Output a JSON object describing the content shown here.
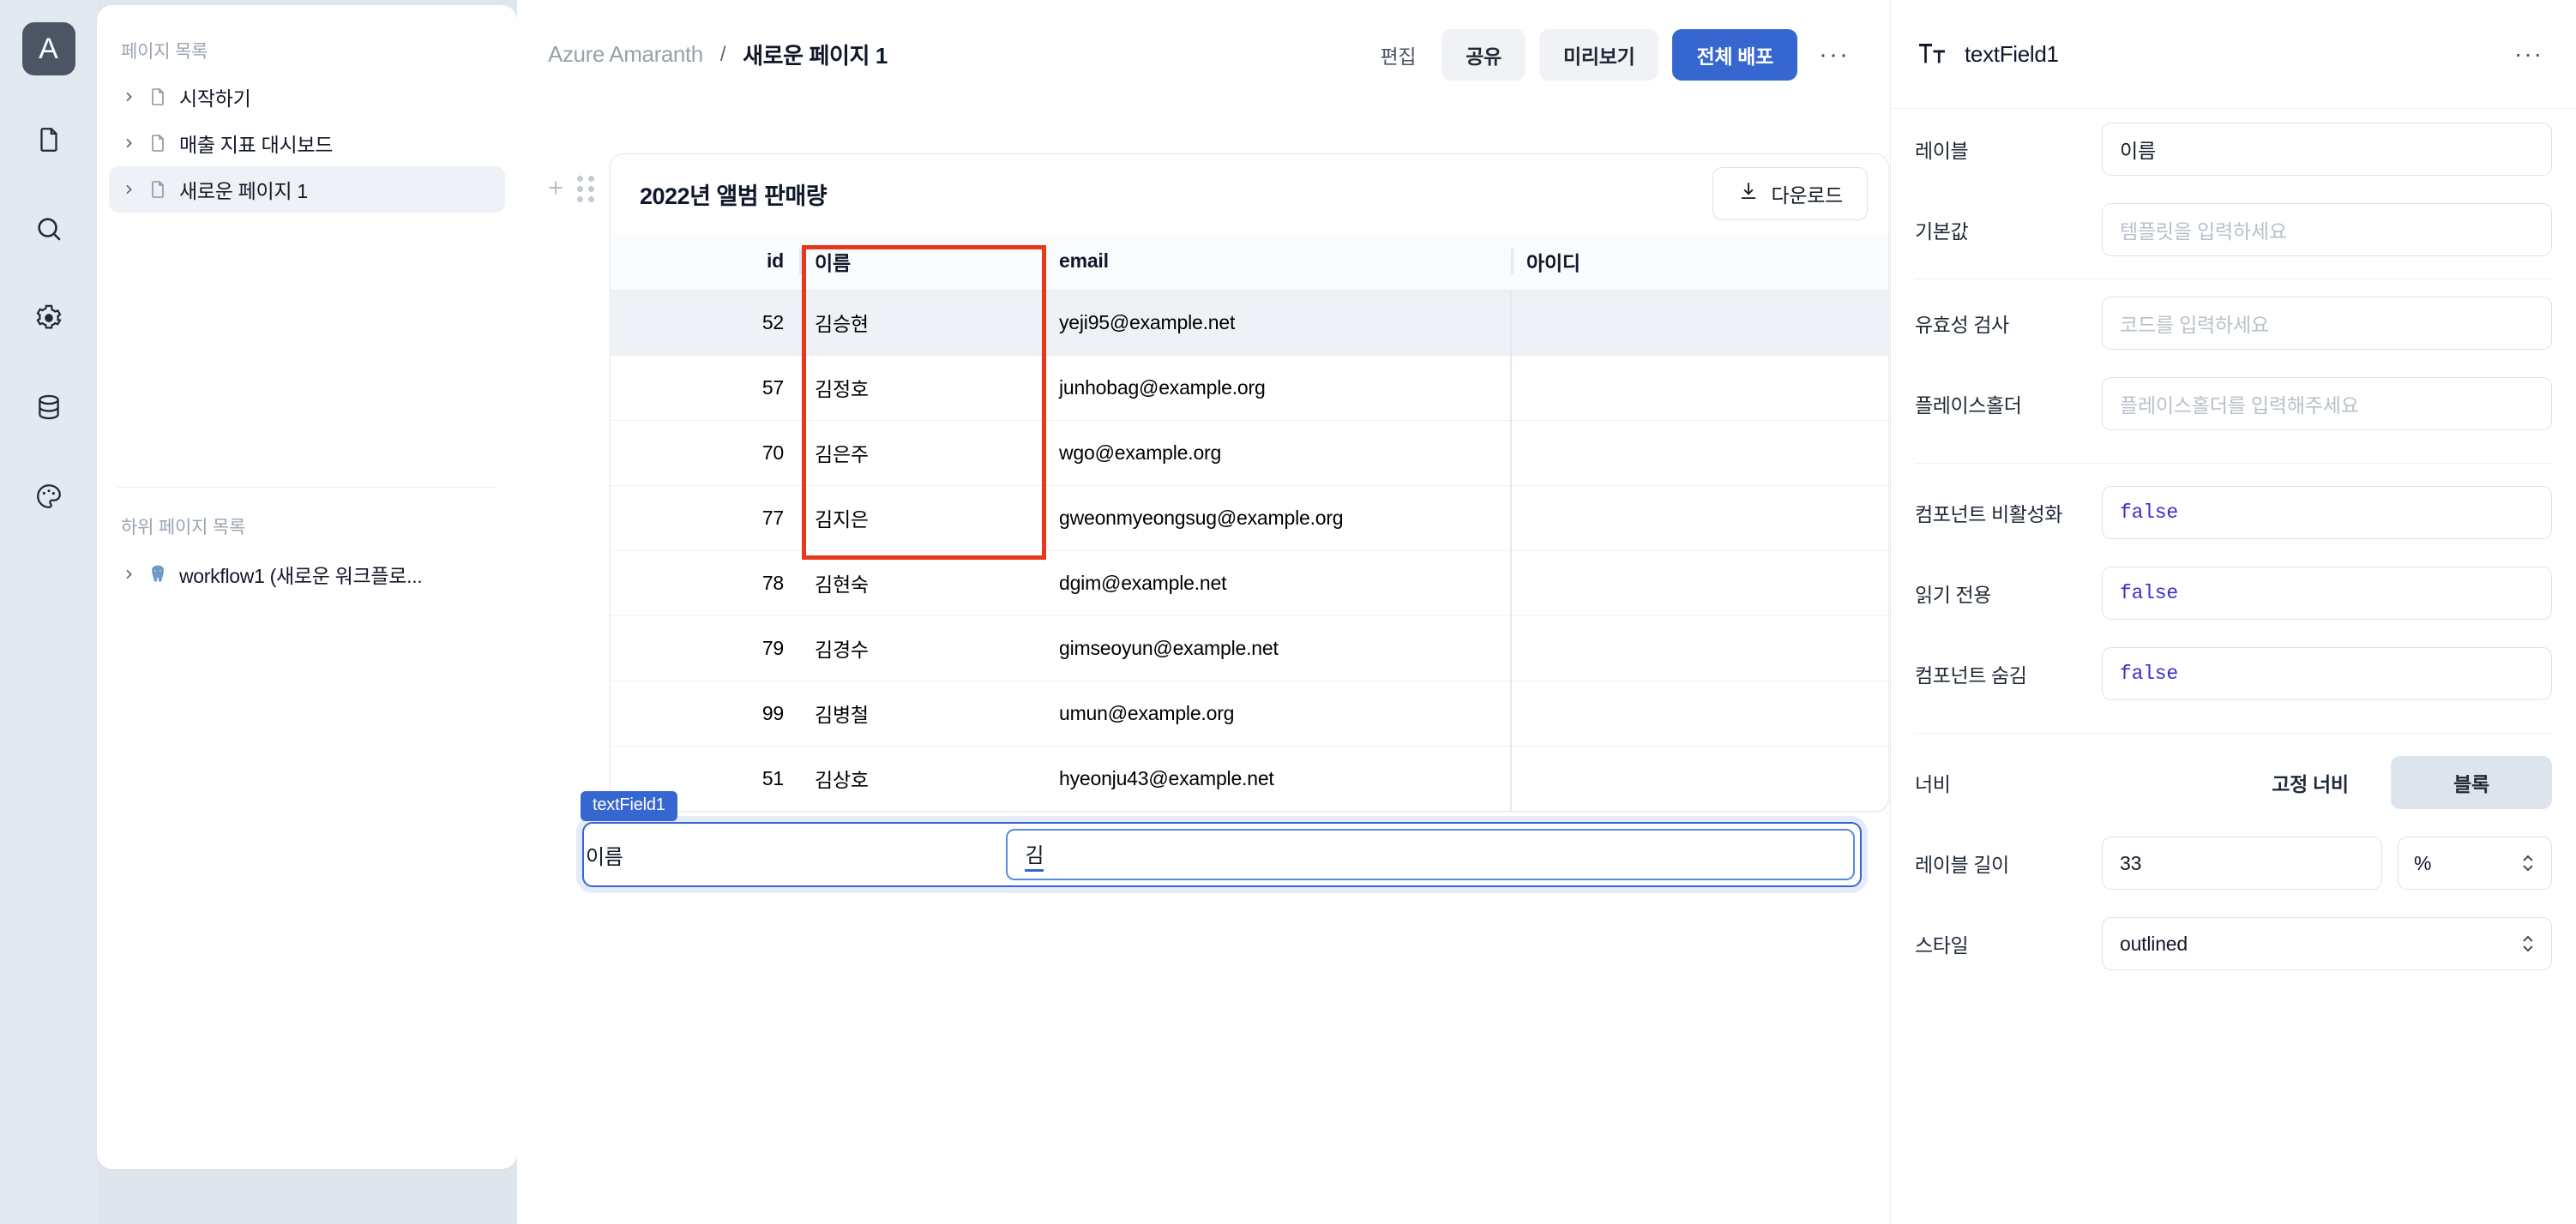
{
  "rail": {
    "logo_label": "A",
    "icons": [
      {
        "name": "page-icon"
      },
      {
        "name": "search-icon"
      },
      {
        "name": "gear-icon"
      },
      {
        "name": "database-icon"
      },
      {
        "name": "palette-icon"
      }
    ]
  },
  "pages_panel": {
    "heading": "페이지 목록",
    "items": [
      {
        "label": "시작하기",
        "icon": "document-icon",
        "active": false
      },
      {
        "label": "매출 지표 대시보드",
        "icon": "document-icon",
        "active": false
      },
      {
        "label": "새로운 페이지 1",
        "icon": "document-icon",
        "active": true
      }
    ],
    "subheading": "하위 페이지 목록",
    "subitems": [
      {
        "label": "workflow1 (새로운 워크플로...",
        "icon": "postgresql-icon"
      }
    ]
  },
  "topbar": {
    "breadcrumb_root": "Azure Amaranth",
    "breadcrumb_sep": "/",
    "breadcrumb_leaf": "새로운 페이지 1",
    "edit_label": "편집",
    "share_label": "공유",
    "preview_label": "미리보기",
    "deploy_label": "전체 배포",
    "kebab_label": "···"
  },
  "widget": {
    "title": "2022년 앨범 판매량",
    "download_label": "다운로드",
    "download_icon": "download-icon",
    "add_icon": "plus-icon",
    "drag_icon": "drag-handle-icon",
    "highlight_color": "#e8381b",
    "columns": [
      "id",
      "이름",
      "email",
      "아이디"
    ],
    "rows": [
      {
        "id": "52",
        "name": "김승현",
        "email": "yeji95@example.net",
        "userid": "",
        "selected": true
      },
      {
        "id": "57",
        "name": "김정호",
        "email": "junhobag@example.org",
        "userid": "",
        "selected": false
      },
      {
        "id": "70",
        "name": "김은주",
        "email": "wgo@example.org",
        "userid": "",
        "selected": false
      },
      {
        "id": "77",
        "name": "김지은",
        "email": "gweonmyeongsug@example.org",
        "userid": "",
        "selected": false
      },
      {
        "id": "78",
        "name": "김현숙",
        "email": "dgim@example.net",
        "userid": "",
        "selected": false
      },
      {
        "id": "79",
        "name": "김경수",
        "email": "gimseoyun@example.net",
        "userid": "",
        "selected": false
      },
      {
        "id": "99",
        "name": "김병철",
        "email": "umun@example.org",
        "userid": "",
        "selected": false
      },
      {
        "id": "51",
        "name": "김상호",
        "email": "hyeonju43@example.net",
        "userid": "",
        "selected": false
      }
    ]
  },
  "text_field_widget": {
    "badge": "textField1",
    "label": "이름",
    "value": "김"
  },
  "props": {
    "icon": "text-field-icon",
    "title": "textField1",
    "kebab_label": "···",
    "rows": [
      {
        "label": "레이블",
        "value": "이름",
        "placeholder": "",
        "kind": "text"
      },
      {
        "label": "기본값",
        "value": "",
        "placeholder": "템플릿을 입력하세요",
        "kind": "text"
      },
      {
        "label": "유효성 검사",
        "value": "",
        "placeholder": "코드를 입력하세요",
        "kind": "text"
      },
      {
        "label": "플레이스홀더",
        "value": "",
        "placeholder": "플레이스홀더를 입력해주세요",
        "kind": "text"
      },
      {
        "label": "컴포넌트 비활성화",
        "value": "false",
        "placeholder": "",
        "kind": "code"
      },
      {
        "label": "읽기 전용",
        "value": "false",
        "placeholder": "",
        "kind": "code"
      },
      {
        "label": "컴포넌트 숨김",
        "value": "false",
        "placeholder": "",
        "kind": "code"
      }
    ],
    "width_row": {
      "label": "너비",
      "option_fixed": "고정 너비",
      "option_block": "블록",
      "selected": "블록"
    },
    "label_length_row": {
      "label": "레이블 길이",
      "value": "33",
      "unit": "%"
    },
    "style_row": {
      "label": "스타일",
      "value": "outlined"
    }
  },
  "colors": {
    "accent": "#3667d0",
    "highlight": "#e8381b",
    "code_value": "#3a30c8",
    "app_bg": "#dfe5ec"
  }
}
